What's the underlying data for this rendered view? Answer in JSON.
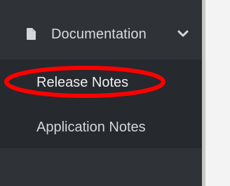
{
  "sidebar": {
    "section": {
      "label": "Documentation",
      "icon": "file-icon",
      "expanded_icon": "chevron-down-icon"
    },
    "submenu": [
      {
        "label": "Release Notes"
      },
      {
        "label": "Application Notes"
      }
    ]
  },
  "annotation": {
    "type": "red-ellipse-highlight",
    "color": "#ff0000",
    "target": "Release Notes"
  },
  "colors": {
    "sidebar_bg": "#2f3338",
    "submenu_bg": "#26292e",
    "text": "#d8dbe0",
    "divider": "#c7c7c7",
    "content_bg": "#f3f3f3"
  }
}
